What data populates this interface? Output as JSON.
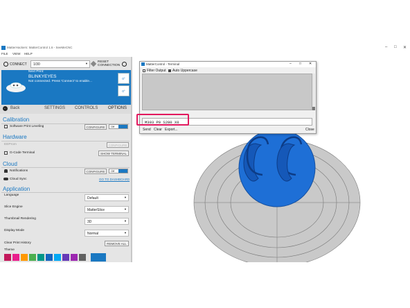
{
  "window": {
    "title": "MatterHackers: MatterControl 1.6 - SeeMeCNC",
    "controls": [
      "–",
      "□",
      "✕"
    ]
  },
  "menu": {
    "items": [
      "FILE",
      "VIEW",
      "HELP"
    ]
  },
  "connection": {
    "connect_label": "CONNECT",
    "printer": "1/30",
    "reset_label_1": "RESET",
    "reset_label_2": "CONNECTION"
  },
  "print_card": {
    "status_heading": "Next Print:",
    "name": "BLINKYEYES",
    "message": "Not connected. Press 'Connect' to enable...",
    "side_buttons": [
      "0°",
      "0°"
    ]
  },
  "nav": {
    "back": "Back",
    "settings": "SETTINGS",
    "controls": "CONTROLS",
    "options": "OPTIONS"
  },
  "calibration": {
    "heading": "Calibration",
    "leveling_label": "Software Print Leveling",
    "configure": "CONFIGURE",
    "toggle": "Off"
  },
  "hardware": {
    "heading": "Hardware",
    "eeprom_label": "EEProm",
    "eeprom_button": "CONFIGURE",
    "gcode_label": "G-Code Terminal",
    "gcode_button": "SHOW TERMINAL"
  },
  "cloud": {
    "heading": "Cloud",
    "notifications_label": "Notifications",
    "notifications_button": "CONFIGURE",
    "notifications_toggle": "Off",
    "sync_label": "Cloud Sync",
    "sync_link": "GO TO DASHBOARD"
  },
  "application": {
    "heading": "Application",
    "language_label": "Language",
    "language_value": "Default",
    "slice_label": "Slice Engine",
    "slice_value": "MatterSlice",
    "thumb_label": "Thumbnail Rendering",
    "thumb_value": "3D",
    "display_label": "Display Mode",
    "display_value": "Normal",
    "clear_label": "Clear Print History",
    "clear_button": "REMOVE ALL",
    "theme_label": "Theme",
    "theme_colors": [
      "#c2185b",
      "#e91e8c",
      "#ff9800",
      "#4caf50",
      "#009688",
      "#1565c0",
      "#03a9f4",
      "#673ab7",
      "#9c27b0",
      "#616161"
    ],
    "theme_selected": "#1a78c2"
  },
  "terminal": {
    "title": "MatterControl - Terminal",
    "filter_label": "Filter Output",
    "uppercase_label": "Auto Uppercase",
    "command": "M303 P0 S280 X0",
    "send": "Send",
    "clear": "Clear",
    "export": "Export...",
    "close": "Close"
  },
  "colors": {
    "accent": "#1a78c2",
    "highlight": "#e2185e",
    "bed": "#c8c8c8",
    "model": "#1e6fd6"
  }
}
